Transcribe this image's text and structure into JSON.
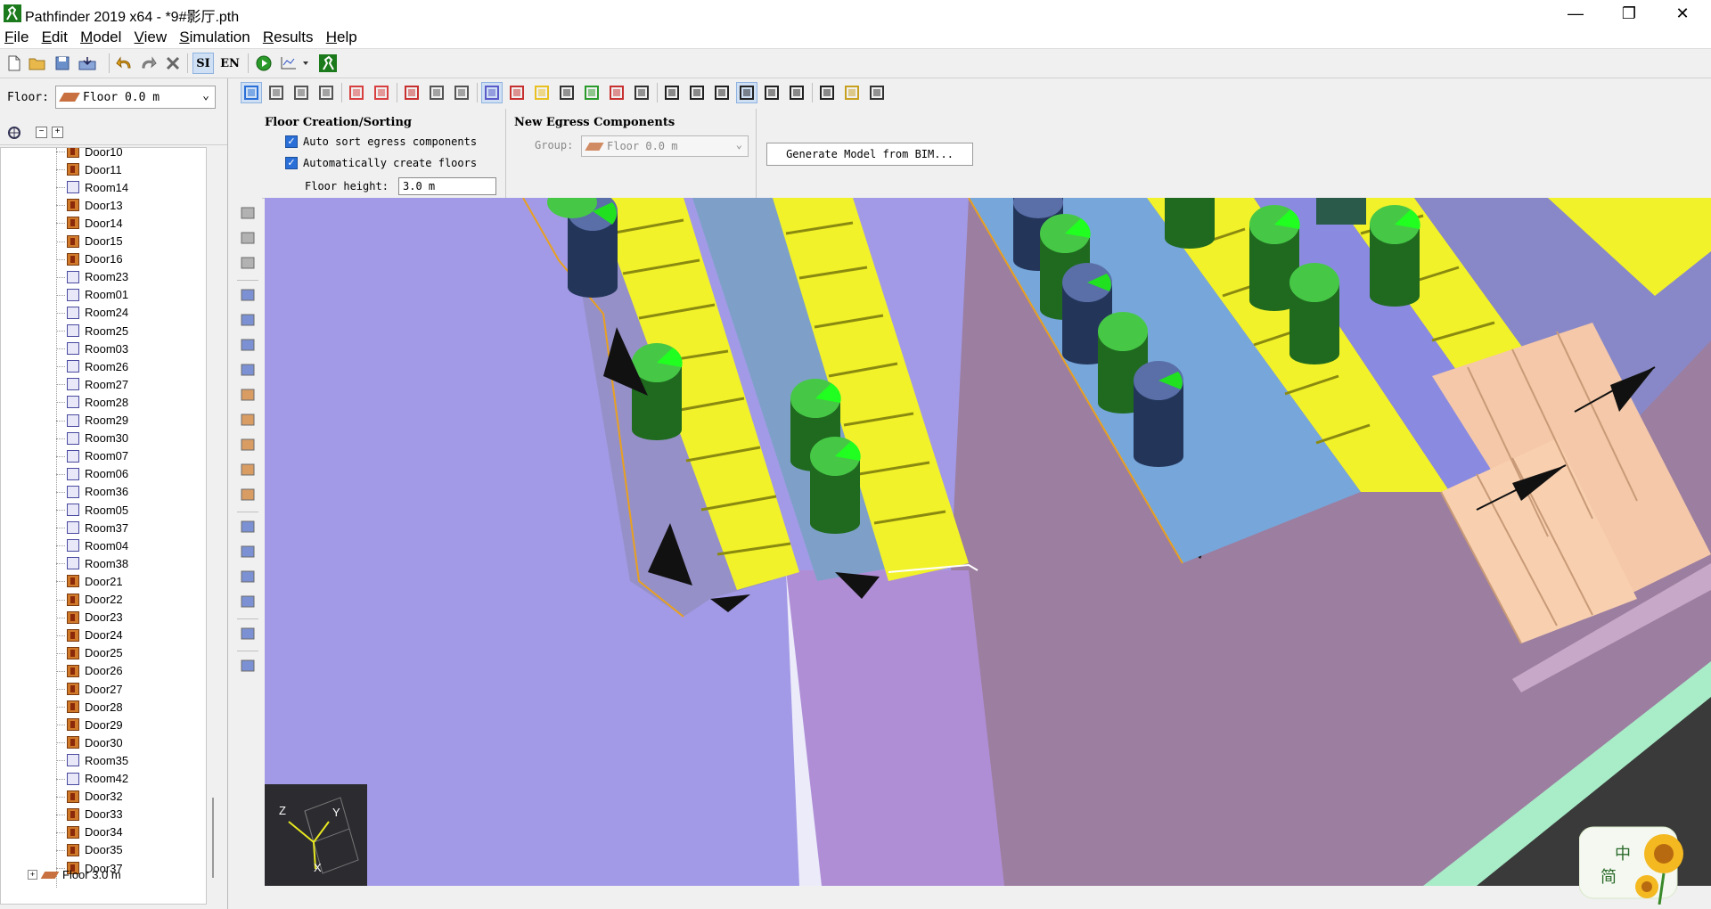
{
  "window": {
    "title": "Pathfinder 2019 x64 - *9#影厅.pth",
    "minimize": "—",
    "restore": "❐",
    "close": "✕"
  },
  "menu": [
    {
      "label": "File",
      "key": "F",
      "rest": "ile"
    },
    {
      "label": "Edit",
      "key": "E",
      "rest": "dit"
    },
    {
      "label": "Model",
      "key": "M",
      "rest": "odel"
    },
    {
      "label": "View",
      "key": "V",
      "rest": "iew"
    },
    {
      "label": "Simulation",
      "key": "S",
      "rest": "imulation"
    },
    {
      "label": "Results",
      "key": "R",
      "rest": "esults"
    },
    {
      "label": "Help",
      "key": "H",
      "rest": "elp"
    }
  ],
  "toolbar": {
    "si_label": "SI",
    "en_label": "EN"
  },
  "left_panel": {
    "floor_label": "Floor:",
    "floor_value": "Floor 0.0 m",
    "tree_items": [
      {
        "label": "Door10",
        "type": "door"
      },
      {
        "label": "Door11",
        "type": "door"
      },
      {
        "label": "Room14",
        "type": "room"
      },
      {
        "label": "Door13",
        "type": "door"
      },
      {
        "label": "Door14",
        "type": "door"
      },
      {
        "label": "Door15",
        "type": "door"
      },
      {
        "label": "Door16",
        "type": "door"
      },
      {
        "label": "Room23",
        "type": "room"
      },
      {
        "label": "Room01",
        "type": "room"
      },
      {
        "label": "Room24",
        "type": "room"
      },
      {
        "label": "Room25",
        "type": "room"
      },
      {
        "label": "Room03",
        "type": "room"
      },
      {
        "label": "Room26",
        "type": "room"
      },
      {
        "label": "Room27",
        "type": "room"
      },
      {
        "label": "Room28",
        "type": "room"
      },
      {
        "label": "Room29",
        "type": "room"
      },
      {
        "label": "Room30",
        "type": "room"
      },
      {
        "label": "Room07",
        "type": "room"
      },
      {
        "label": "Room06",
        "type": "room"
      },
      {
        "label": "Room36",
        "type": "room"
      },
      {
        "label": "Room05",
        "type": "room"
      },
      {
        "label": "Room37",
        "type": "room"
      },
      {
        "label": "Room04",
        "type": "room"
      },
      {
        "label": "Room38",
        "type": "room"
      },
      {
        "label": "Door21",
        "type": "door"
      },
      {
        "label": "Door22",
        "type": "door"
      },
      {
        "label": "Door23",
        "type": "door"
      },
      {
        "label": "Door24",
        "type": "door"
      },
      {
        "label": "Door25",
        "type": "door"
      },
      {
        "label": "Door26",
        "type": "door"
      },
      {
        "label": "Door27",
        "type": "door"
      },
      {
        "label": "Door28",
        "type": "door"
      },
      {
        "label": "Door29",
        "type": "door"
      },
      {
        "label": "Door30",
        "type": "door"
      },
      {
        "label": "Room35",
        "type": "room"
      },
      {
        "label": "Room42",
        "type": "room"
      },
      {
        "label": "Door32",
        "type": "door"
      },
      {
        "label": "Door33",
        "type": "door"
      },
      {
        "label": "Door34",
        "type": "door"
      },
      {
        "label": "Door35",
        "type": "door"
      },
      {
        "label": "Door37",
        "type": "door"
      }
    ],
    "next_floor": "Floor 3.0 m"
  },
  "properties": {
    "floor_section_title": "Floor Creation/Sorting",
    "auto_sort_label": "Auto sort egress components",
    "auto_create_label": "Automatically create floors",
    "floor_height_label": "Floor height:",
    "floor_height_value": "3.0 m",
    "egress_section_title": "New Egress Components",
    "group_label": "Group:",
    "group_value": "Floor 0.0 m",
    "generate_button": "Generate Model from BIM..."
  },
  "axis": {
    "z": "Z",
    "y": "Y",
    "x": "X"
  },
  "logo": {
    "text1": "中",
    "text2": "简"
  }
}
